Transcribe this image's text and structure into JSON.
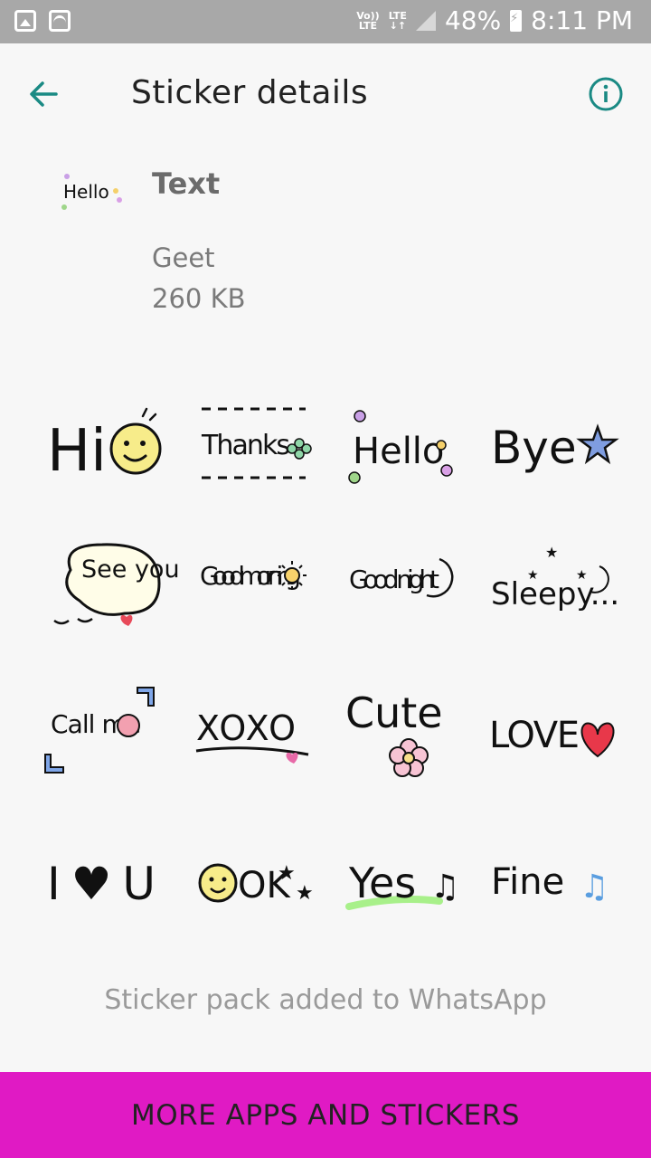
{
  "status_bar": {
    "network_top": "Vo))",
    "network_bottom": "LTE",
    "lte_top": "LTE",
    "lte_bottom": "↓↑",
    "battery": "48%",
    "time": "8:11 PM"
  },
  "app_bar": {
    "title": "Sticker details"
  },
  "pack": {
    "icon_text": "Hello",
    "name": "Text",
    "author": "Geet",
    "size": "260 KB"
  },
  "stickers": [
    {
      "text": "Hi"
    },
    {
      "text": "Thanks"
    },
    {
      "text": "Hello"
    },
    {
      "text": "Bye"
    },
    {
      "text": "See you"
    },
    {
      "text": "Good morning"
    },
    {
      "text": "Good night"
    },
    {
      "text": "Sleepy..."
    },
    {
      "text": "Call me"
    },
    {
      "text": "XOXO"
    },
    {
      "text": "Cute"
    },
    {
      "text": "LOVE"
    },
    {
      "text": "I♥U"
    },
    {
      "text": "OK"
    },
    {
      "text": "Yes"
    },
    {
      "text": "Fine"
    }
  ],
  "status_message": "Sticker pack added to WhatsApp",
  "more_button": "MORE APPS AND STICKERS",
  "colors": {
    "accent": "#1a8a84",
    "button_bg": "#e01ac4",
    "statusbar_bg": "#a8a8a8"
  }
}
